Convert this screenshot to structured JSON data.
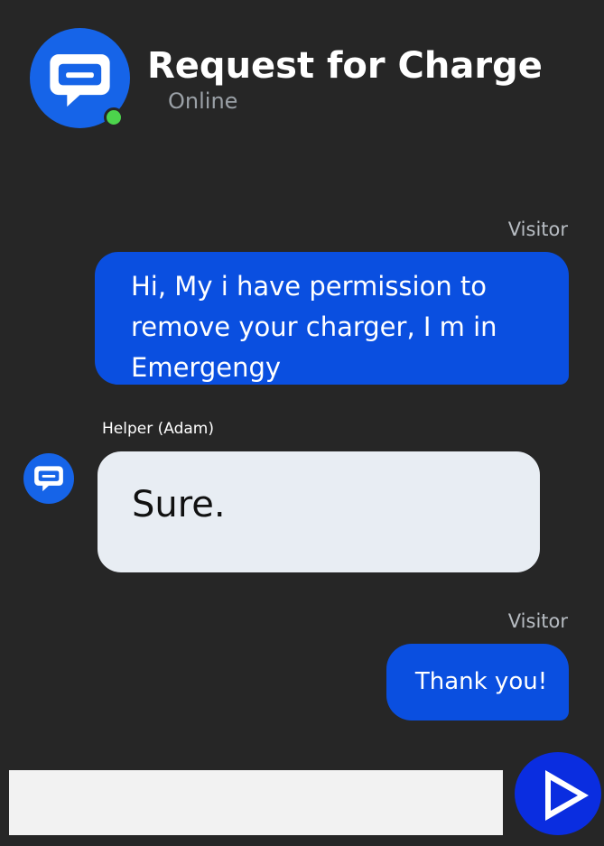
{
  "header": {
    "title": "Request for Charge",
    "status": "Online",
    "avatar_icon": "chat-bubble-icon",
    "status_color": "#4cd44c"
  },
  "messages": [
    {
      "sender": "Visitor",
      "text": "Hi, My i have permission to remove your charger, I m in Emergengy"
    },
    {
      "sender": "Helper (Adam)",
      "text": "Sure."
    },
    {
      "sender": "Visitor",
      "text": "Thank you!"
    }
  ],
  "composer": {
    "value": "",
    "send_icon": "play-triangle-icon"
  },
  "colors": {
    "background": "#262626",
    "visitor_bubble": "#0a4fe0",
    "helper_bubble": "#e8edf3",
    "brand": "#1664e8",
    "send_button": "#0a2de0"
  }
}
